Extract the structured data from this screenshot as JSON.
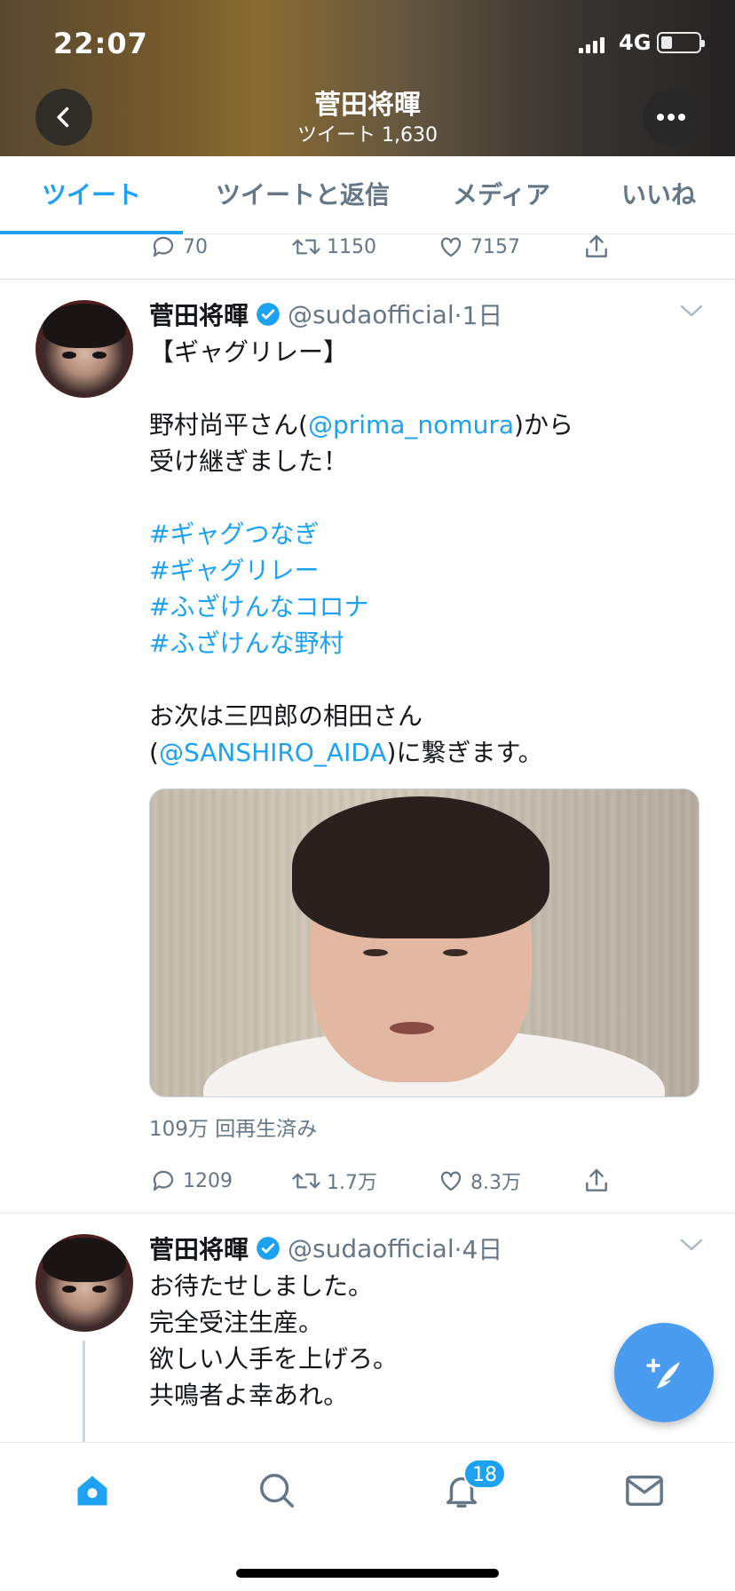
{
  "status_bar": {
    "time": "22:07",
    "network": "4G"
  },
  "header": {
    "name": "菅田将暉",
    "tweet_count": "ツイート 1,630"
  },
  "tabs": [
    {
      "label": "ツイート",
      "active": true
    },
    {
      "label": "ツイートと返信",
      "active": false
    },
    {
      "label": "メディア",
      "active": false
    },
    {
      "label": "いいね",
      "active": false
    }
  ],
  "prev_tweet_actions": {
    "replies": "70",
    "retweets": "1150",
    "likes": "7157"
  },
  "tweet1": {
    "name": "菅田将暉",
    "handle": "@sudaofficial",
    "time": "·1日",
    "lines": [
      {
        "text": "【ギャグリレー】"
      },
      {
        "text": ""
      },
      {
        "pre": "野村尚平さん(",
        "link": "@prima_nomura",
        "post": ")から"
      },
      {
        "text": "受け継ぎました！"
      },
      {
        "text": ""
      },
      {
        "hashtag": "#ギャグつなぎ"
      },
      {
        "hashtag": "#ギャグリレー"
      },
      {
        "hashtag": "#ふざけんなコロナ"
      },
      {
        "hashtag": "#ふざけんな野村"
      },
      {
        "text": ""
      },
      {
        "text": "お次は三四郎の相田さん"
      },
      {
        "pre": "(",
        "link": "@SANSHIRO_AIDA",
        "post": ")に繋ぎます。"
      }
    ],
    "views": "109万 回再生済み",
    "actions": {
      "replies": "1209",
      "retweets": "1.7万",
      "likes": "8.3万"
    }
  },
  "tweet2": {
    "name": "菅田将暉",
    "handle": "@sudaofficial",
    "time": "·4日",
    "lines": [
      "お待たせしました。",
      "完全受注生産。",
      "欲しい人手を上げろ。",
      "共鳴者よ幸あれ。"
    ]
  },
  "bottom_nav": {
    "notifications_badge": "18"
  },
  "colors": {
    "accent": "#1da1f2",
    "muted": "#657786",
    "text": "#14171a"
  }
}
